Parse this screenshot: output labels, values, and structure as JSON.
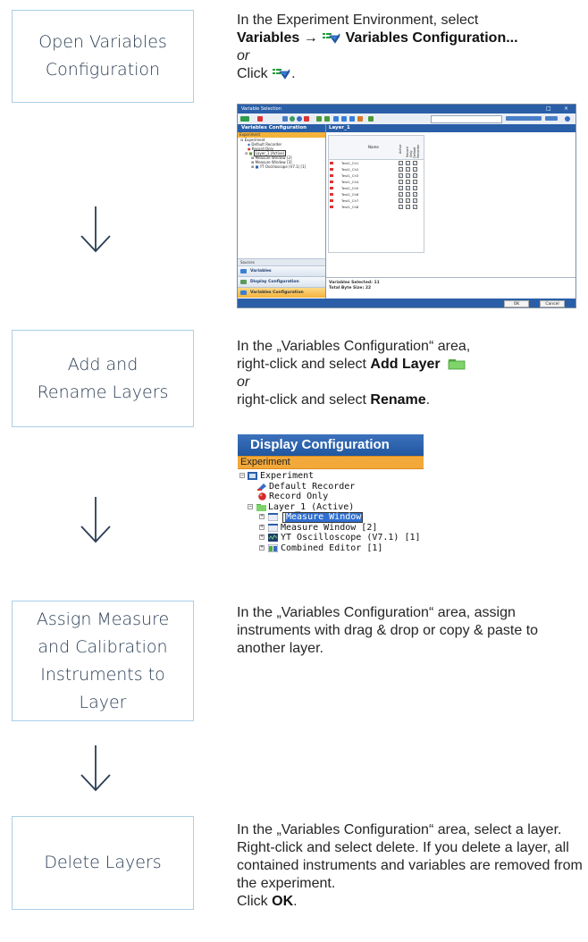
{
  "steps": [
    {
      "label": "Open Variables Configuration"
    },
    {
      "label": "Add and Rename Layers"
    },
    {
      "label": "Assign Measure and Calibration Instruments to Layer"
    },
    {
      "label": "Delete Layers"
    }
  ],
  "step1": {
    "line1": "In the Experiment Environment, select",
    "menu_variables": "Variables →",
    "menu_config": "Variables Configuration...",
    "or": "or",
    "click": "Click",
    "click_suffix": "."
  },
  "step2": {
    "line1": "In the „Variables Configuration“ area,",
    "line2_prefix": "right-click and select",
    "add_layer": "Add Layer",
    "or": "or",
    "line3_prefix": "right-click and select",
    "rename": "Rename",
    "line3_suffix": "."
  },
  "step3": {
    "text": "In the „Variables Configuration“ area, assign instruments with drag & drop or copy & paste to another layer."
  },
  "step4": {
    "text": "In the „Variables Configuration“ area, select a layer. Right-click and select delete. If you delete a layer, all contained instruments and variables are removed from the experiment.",
    "click": "Click",
    "ok": "OK",
    "suffix": "."
  },
  "shot1": {
    "window_title": "Variable Selection",
    "left_header": "Variables Configuration",
    "experiment_label": "Experiment",
    "tree": [
      "Experiment",
      "Default Recorder",
      "Record Only",
      "Layer_1 (Active)",
      "Measure Window [2]",
      "Measure Window [3]",
      "YT Oscilloscope (V7.1) [1]"
    ],
    "sources_label": "Sources",
    "sources": [
      "Variables",
      "Display Configuration",
      "Variables Configuration"
    ],
    "right_header": "Layer_1",
    "column_name": "Name",
    "column_checks": [
      "Active",
      "Record Only",
      "Default Recorder"
    ],
    "rows": [
      "Test1_Ch1",
      "Test1_Ch2",
      "Test1_Ch3",
      "Test1_Ch4",
      "Test1_Ch5",
      "Test1_Ch6",
      "Test1_Ch7",
      "Test1_Ch8"
    ],
    "selected_label": "Variables Selected: 11",
    "bytes_label": "Total Byte Size: 22",
    "ok": "OK",
    "cancel": "Cancel"
  },
  "shot2": {
    "header": "Display Configuration",
    "experiment_label": "Experiment",
    "tree": [
      "Experiment",
      "Default Recorder",
      "Record Only",
      "Layer_1 (Active)",
      "Measure Window",
      "Measure Window [2]",
      "YT Oscilloscope (V7.1) [1]",
      "Combined Editor [1]"
    ],
    "editing_value": "Measure Window"
  },
  "colors": {
    "box_border": "#a9cfe9",
    "box_text": "#2a3d55",
    "header_blue": "#2a5fa8",
    "orange": "#f3a93a"
  }
}
